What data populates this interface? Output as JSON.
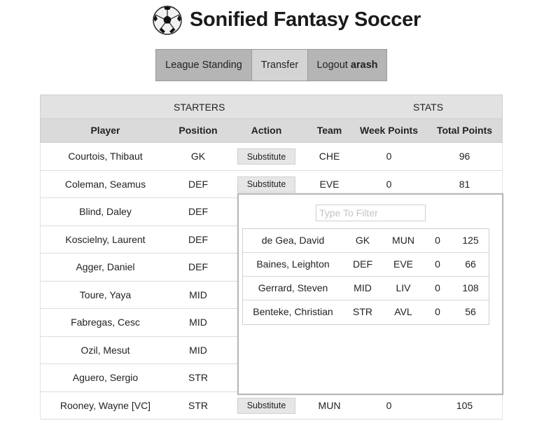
{
  "app": {
    "title": "Sonified Fantasy Soccer",
    "logo_icon": "soccer-ball-icon"
  },
  "nav": {
    "league_standing": "League Standing",
    "transfer": "Transfer",
    "logout_label": "Logout",
    "username": "arash"
  },
  "table": {
    "group_starters": "STARTERS",
    "group_stats": "STATS",
    "columns": [
      "Player",
      "Position",
      "Action",
      "Team",
      "Week Points",
      "Total Points"
    ],
    "rows": [
      {
        "player": "Courtois, Thibaut",
        "position": "GK",
        "action": "Substitute",
        "team": "CHE",
        "week": "0",
        "total": "96"
      },
      {
        "player": "Coleman, Seamus",
        "position": "DEF",
        "action": "Substitute",
        "team": "EVE",
        "week": "0",
        "total": "81"
      },
      {
        "player": "Blind, Daley",
        "position": "DEF",
        "action": "",
        "team": "",
        "week": "",
        "total": ""
      },
      {
        "player": "Koscielny, Laurent",
        "position": "DEF",
        "action": "",
        "team": "",
        "week": "",
        "total": ""
      },
      {
        "player": "Agger, Daniel",
        "position": "DEF",
        "action": "",
        "team": "",
        "week": "",
        "total": ""
      },
      {
        "player": "Toure, Yaya",
        "position": "MID",
        "action": "",
        "team": "",
        "week": "",
        "total": ""
      },
      {
        "player": "Fabregas, Cesc",
        "position": "MID",
        "action": "",
        "team": "",
        "week": "",
        "total": ""
      },
      {
        "player": "Ozil, Mesut",
        "position": "MID",
        "action": "",
        "team": "",
        "week": "",
        "total": ""
      },
      {
        "player": "Aguero, Sergio",
        "position": "STR",
        "action": "",
        "team": "",
        "week": "",
        "total": ""
      },
      {
        "player": "Rooney, Wayne [VC]",
        "position": "STR",
        "action": "Substitute",
        "team": "MUN",
        "week": "0",
        "total": "105"
      }
    ]
  },
  "popup": {
    "filter_placeholder": "Type To Filter",
    "filter_value": "",
    "candidates": [
      {
        "player": "de Gea, David",
        "position": "GK",
        "team": "MUN",
        "week": "0",
        "total": "125"
      },
      {
        "player": "Baines, Leighton",
        "position": "DEF",
        "team": "EVE",
        "week": "0",
        "total": "66"
      },
      {
        "player": "Gerrard, Steven",
        "position": "MID",
        "team": "LIV",
        "week": "0",
        "total": "108"
      },
      {
        "player": "Benteke, Christian",
        "position": "STR",
        "team": "AVL",
        "week": "0",
        "total": "56"
      }
    ]
  }
}
